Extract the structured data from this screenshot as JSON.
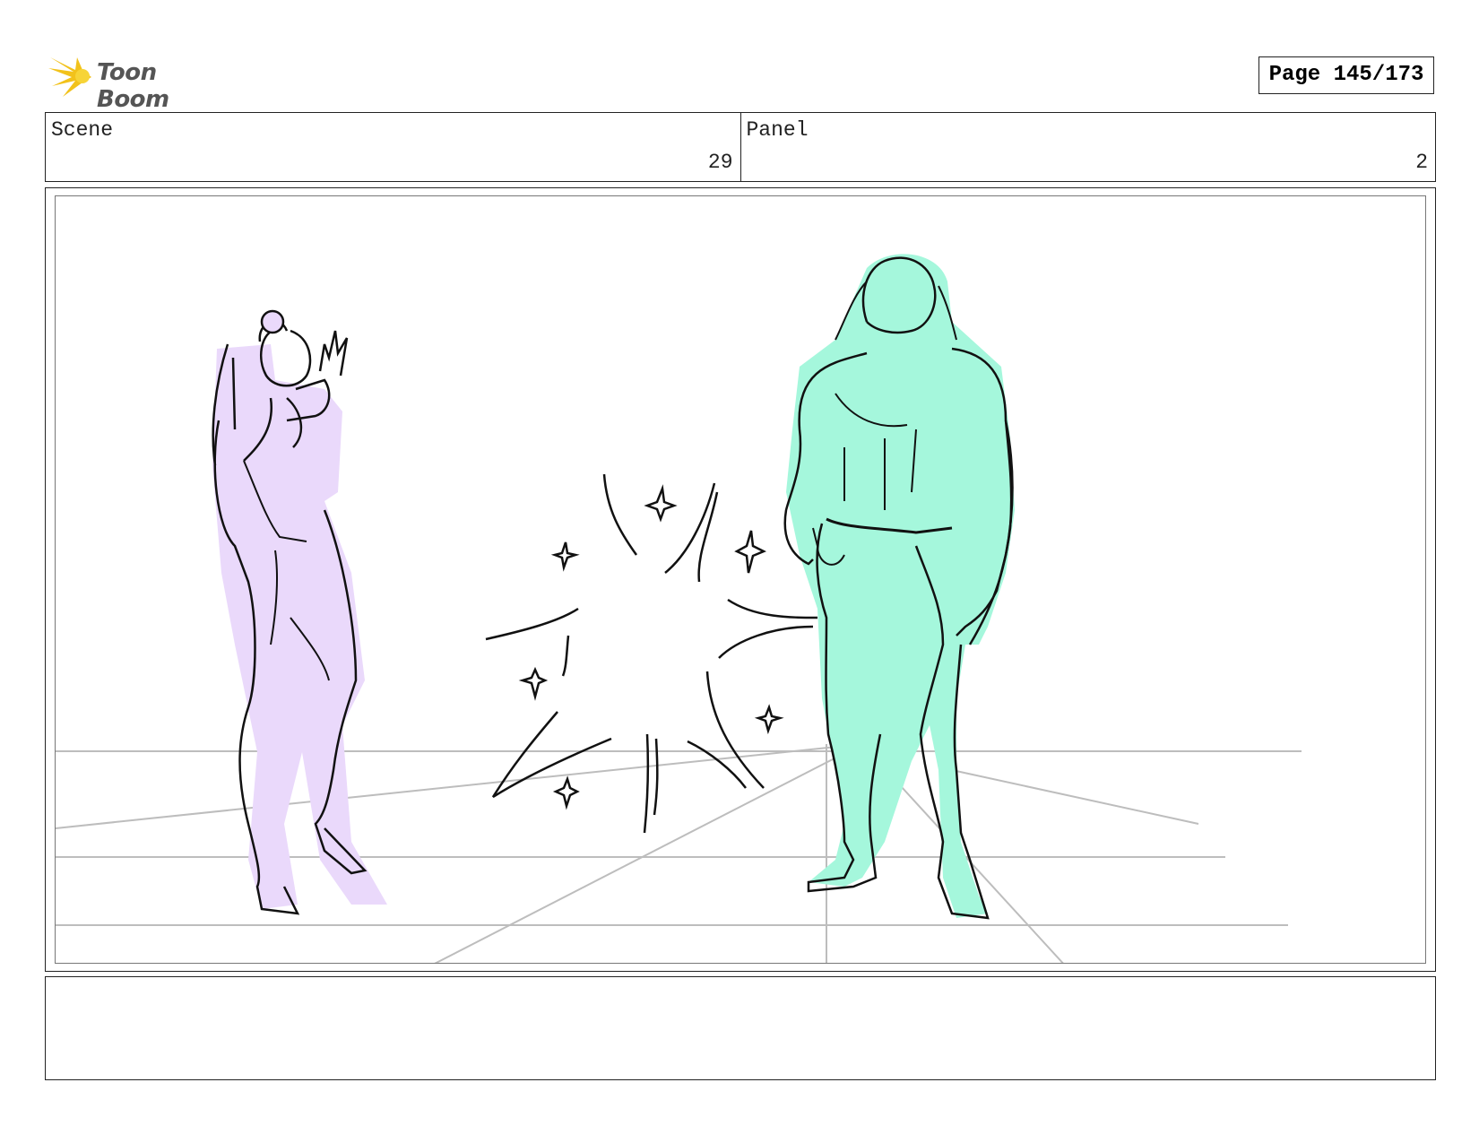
{
  "brand": {
    "name": "Toon Boom",
    "accent": "#f2c21b"
  },
  "page": {
    "label": "Page 145/173"
  },
  "header": {
    "scene_label": "Scene",
    "scene_value": "29",
    "panel_label": "Panel",
    "panel_value": "2"
  },
  "drawing": {
    "left_figure_color": "#ead9fb",
    "right_figure_color": "#a5f7dc",
    "line_color": "#111111",
    "guide_color": "#bdbdbd"
  },
  "notes": {
    "text": ""
  }
}
